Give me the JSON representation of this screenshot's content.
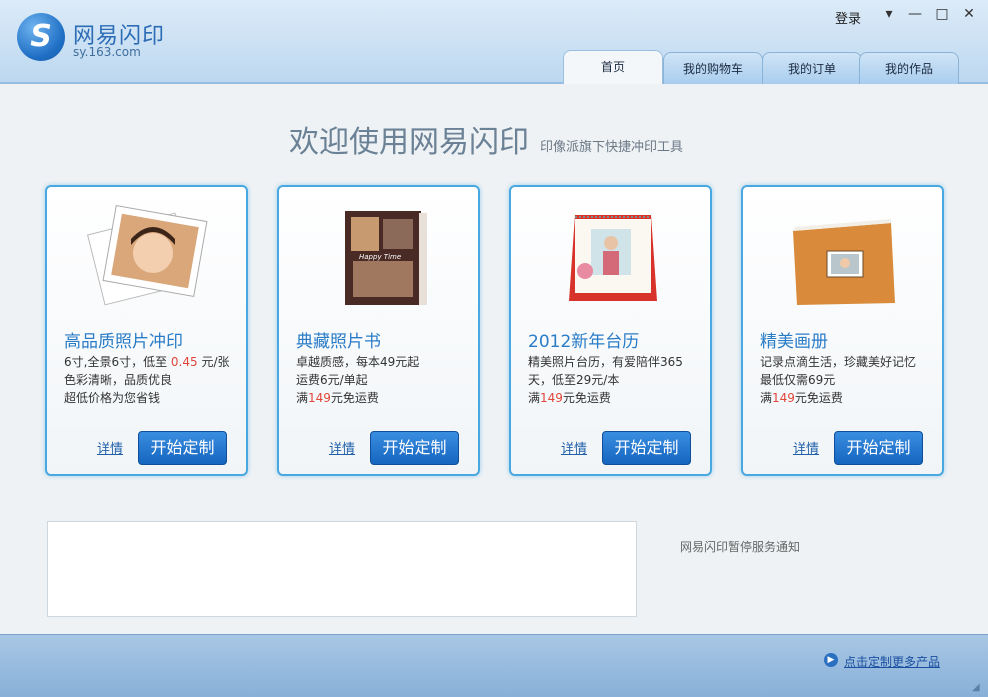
{
  "app": {
    "brand_name": "网易闪印",
    "brand_url": "sy.163.com",
    "login": "登录"
  },
  "tabs": [
    {
      "label": "首页",
      "active": true
    },
    {
      "label": "我的购物车",
      "active": false
    },
    {
      "label": "我的订单",
      "active": false
    },
    {
      "label": "我的作品",
      "active": false
    }
  ],
  "welcome": {
    "title": "欢迎使用网易闪印",
    "subtitle": "印像派旗下快捷冲印工具"
  },
  "cards": [
    {
      "title": "高品质照片冲印",
      "lines": [
        [
          "6寸,全景6寸，低至 ",
          "0.45",
          " 元/张"
        ],
        [
          "色彩清晰，品质优良",
          "",
          ""
        ],
        [
          "超低价格为您省钱",
          "",
          ""
        ]
      ],
      "detail": "详情",
      "button": "开始定制"
    },
    {
      "title": "典藏照片书",
      "lines": [
        [
          "卓越质感，每本49元起",
          "",
          ""
        ],
        [
          "运费6元/单起",
          "",
          ""
        ],
        [
          "满",
          "149",
          "元免运费"
        ]
      ],
      "detail": "详情",
      "button": "开始定制"
    },
    {
      "title": "2012新年台历",
      "lines": [
        [
          "精美照片台历，有爱陪伴365",
          "",
          ""
        ],
        [
          "天，低至29元/本",
          "",
          ""
        ],
        [
          "满",
          "149",
          "元免运费"
        ]
      ],
      "detail": "详情",
      "button": "开始定制"
    },
    {
      "title": "精美画册",
      "lines": [
        [
          "记录点滴生活，珍藏美好记忆",
          "",
          ""
        ],
        [
          "最低仅需69元",
          "",
          ""
        ],
        [
          "满",
          "149",
          "元免运费"
        ]
      ],
      "detail": "详情",
      "button": "开始定制"
    }
  ],
  "notice": "网易闪印暂停服务通知",
  "footer": {
    "more_link": "点击定制更多产品"
  },
  "colors": {
    "accent_blue": "#2a7cc7",
    "price_red": "#e0463a",
    "card_border": "#4aa8e0"
  }
}
